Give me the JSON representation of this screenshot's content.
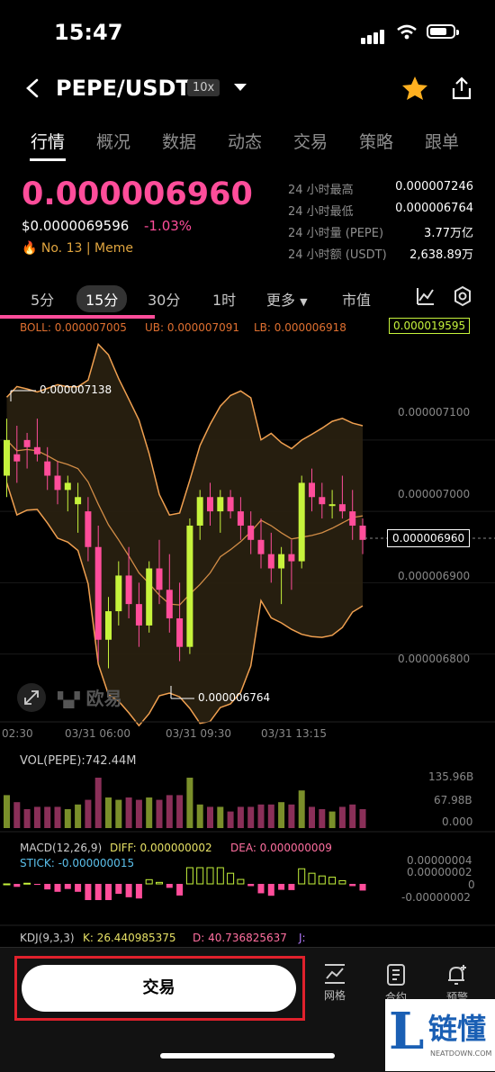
{
  "status_bar": {
    "time": "15:47"
  },
  "header": {
    "pair": "PEPE/USDT",
    "leverage": "10x"
  },
  "tabs": [
    "行情",
    "概况",
    "数据",
    "动态",
    "交易",
    "策略",
    "跟单"
  ],
  "price": {
    "last": "0.000006960",
    "usd": "$0.0000069596",
    "change": "-1.03%",
    "rank": "No. 13",
    "category": "Meme"
  },
  "stats": [
    {
      "label": "24 小时最高",
      "value": "0.000007246"
    },
    {
      "label": "24 小时最低",
      "value": "0.000006764"
    },
    {
      "label": "24 小时量 (PEPE)",
      "value": "3.77万亿"
    },
    {
      "label": "24 小时额 (USDT)",
      "value": "2,638.89万"
    }
  ],
  "intervals": [
    "5分",
    "15分",
    "30分",
    "1时",
    "更多",
    "市值"
  ],
  "indicators": {
    "boll": "BOLL: 0.000007005",
    "ub": "UB: 0.000007091",
    "lb": "LB: 0.000006918",
    "top_price_tag": "0.000019595",
    "high_label": "0.000007138",
    "low_label": "0.000006764",
    "current_tag": "0.000006960",
    "watermark": "欧易"
  },
  "y_axis": [
    "0.000007100",
    "0.000007000",
    "0.000006900",
    "0.000006800"
  ],
  "x_axis": [
    "02:30",
    "03/31 06:00",
    "03/31 09:30",
    "03/31 13:15"
  ],
  "volume": {
    "title": "VOL(PEPE):742.44M",
    "ticks": [
      "135.96B",
      "67.98B",
      "0.000"
    ]
  },
  "macd": {
    "title": "MACD(12,26,9)",
    "diff": "DIFF: 0.000000002",
    "dea": "DEA: 0.000000009",
    "stick": "STICK: -0.000000015",
    "ticks": [
      "0.00000004",
      "0.00000002",
      "0",
      "-0.00000002"
    ]
  },
  "kdj": {
    "title": "KDJ(9,3,3)",
    "k": "K: 26.440985375",
    "d": "D: 40.736825637",
    "j": "J:"
  },
  "bottom": {
    "trade": "交易",
    "grid": "网格",
    "contract": "合约",
    "alert": "预警"
  },
  "watermark_site": {
    "title": "链懂",
    "letter": "L",
    "url": "NEATDOWN.COM"
  },
  "colors": {
    "up": "#c6f33c",
    "down": "#ff4d9a",
    "accent": "#ffb020"
  },
  "chart_data": {
    "type": "candlestick",
    "ylim": [
      6.7e-06,
      7.2e-06
    ],
    "candles": [
      [
        7.05,
        7.13,
        7.02,
        7.1
      ],
      [
        7.08,
        7.12,
        7.04,
        7.07
      ],
      [
        7.1,
        7.11,
        7.06,
        7.09
      ],
      [
        7.09,
        7.13,
        7.07,
        7.08
      ],
      [
        7.07,
        7.09,
        7.03,
        7.05
      ],
      [
        7.05,
        7.07,
        7.01,
        7.03
      ],
      [
        7.03,
        7.05,
        7.0,
        7.04
      ],
      [
        7.01,
        7.04,
        6.97,
        7.02
      ],
      [
        7.0,
        7.02,
        6.93,
        6.95
      ],
      [
        6.95,
        6.98,
        6.79,
        6.82
      ],
      [
        6.82,
        6.88,
        6.78,
        6.86
      ],
      [
        6.86,
        6.93,
        6.84,
        6.91
      ],
      [
        6.91,
        6.95,
        6.85,
        6.87
      ],
      [
        6.87,
        6.9,
        6.81,
        6.84
      ],
      [
        6.84,
        6.93,
        6.83,
        6.92
      ],
      [
        6.92,
        6.96,
        6.87,
        6.89
      ],
      [
        6.89,
        6.94,
        6.83,
        6.85
      ],
      [
        6.85,
        6.9,
        6.79,
        6.81
      ],
      [
        6.81,
        6.99,
        6.8,
        6.98
      ],
      [
        6.98,
        7.03,
        6.96,
        7.02
      ],
      [
        7.02,
        7.04,
        6.98,
        7.0
      ],
      [
        7.0,
        7.03,
        6.97,
        7.02
      ],
      [
        7.02,
        7.03,
        6.99,
        7.0
      ],
      [
        7.0,
        7.02,
        6.96,
        6.98
      ],
      [
        6.98,
        7.0,
        6.94,
        6.96
      ],
      [
        6.96,
        6.99,
        6.92,
        6.94
      ],
      [
        6.94,
        6.97,
        6.9,
        6.92
      ],
      [
        6.92,
        6.95,
        6.87,
        6.94
      ],
      [
        6.94,
        6.96,
        6.89,
        6.93
      ],
      [
        6.93,
        7.05,
        6.92,
        7.04
      ],
      [
        7.04,
        7.06,
        7.0,
        7.02
      ],
      [
        7.02,
        7.04,
        6.99,
        7.01
      ],
      [
        7.01,
        7.03,
        6.99,
        7.01
      ],
      [
        7.01,
        7.05,
        6.99,
        7.0
      ],
      [
        7.0,
        7.03,
        6.96,
        6.98
      ],
      [
        6.98,
        6.99,
        6.94,
        6.96
      ]
    ]
  }
}
